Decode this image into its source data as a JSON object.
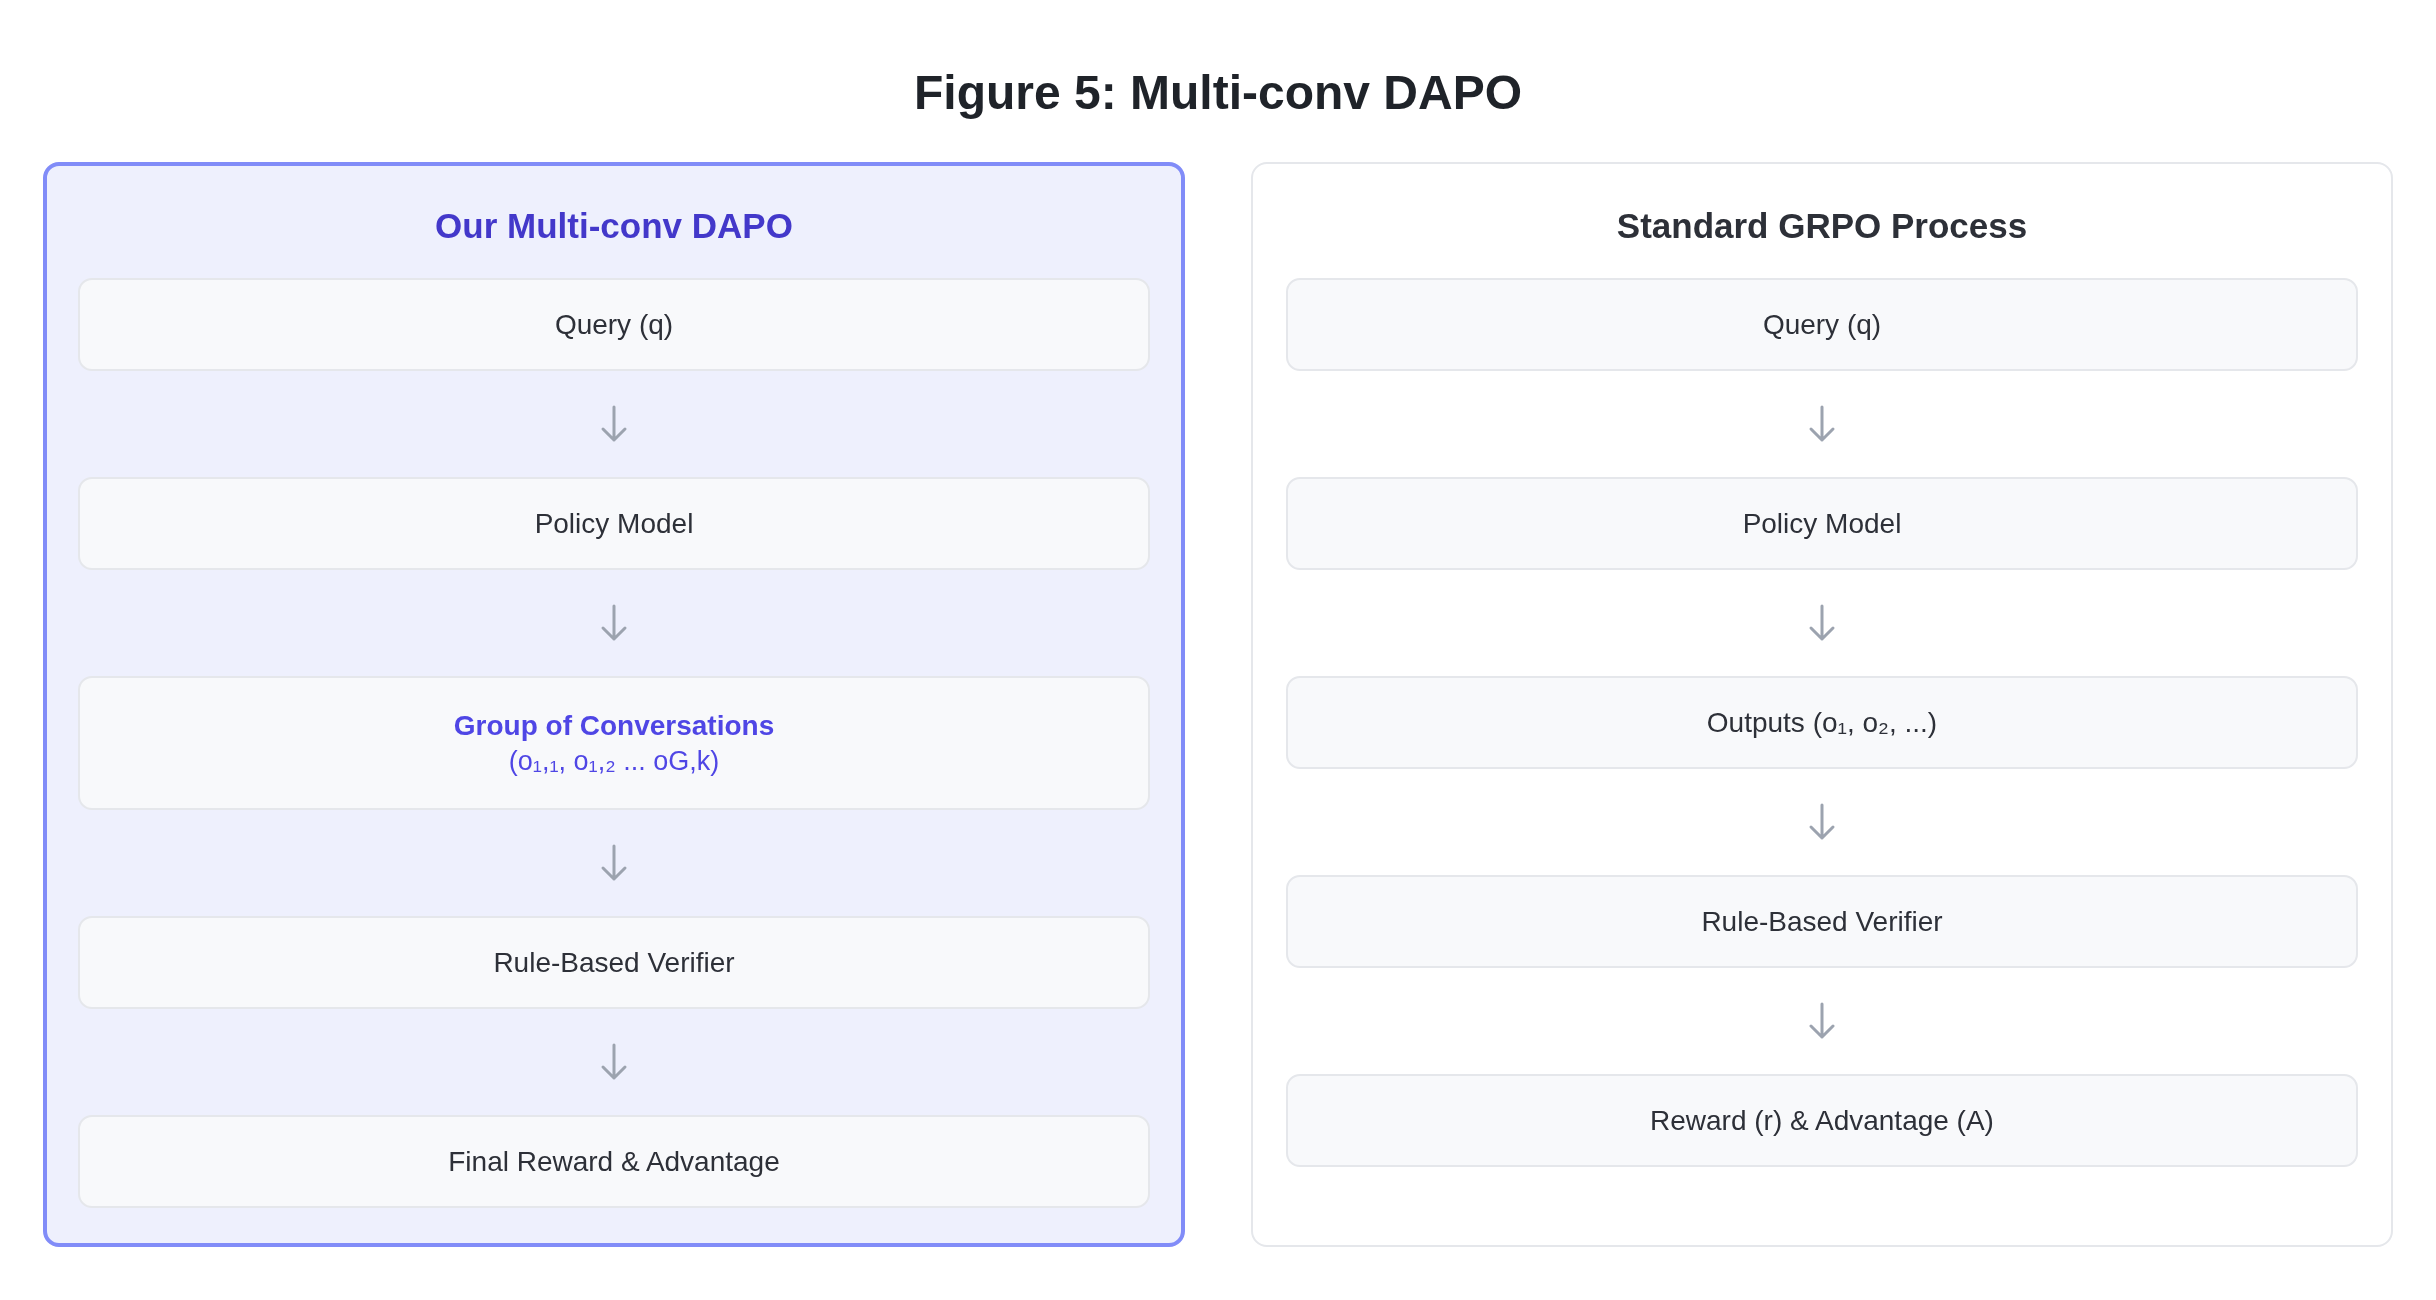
{
  "title": "Figure 5: Multi-conv DAPO",
  "panels": [
    {
      "title": "Our Multi-conv DAPO",
      "highlighted": true,
      "steps": [
        {
          "kind": "plain",
          "label": "Query (q)"
        },
        {
          "kind": "plain",
          "label": "Policy Model"
        },
        {
          "kind": "highlight",
          "label": "Group of Conversations",
          "detail": "(o₁,₁, o₁,₂ ... oG,k)"
        },
        {
          "kind": "plain",
          "label": "Rule-Based Verifier"
        },
        {
          "kind": "plain",
          "label": "Final Reward & Advantage"
        }
      ]
    },
    {
      "title": "Standard GRPO Process",
      "highlighted": false,
      "steps": [
        {
          "kind": "plain",
          "label": "Query (q)"
        },
        {
          "kind": "plain",
          "label": "Policy Model"
        },
        {
          "kind": "plain",
          "label": "Outputs (o₁, o₂, ...)"
        },
        {
          "kind": "plain",
          "label": "Rule-Based Verifier"
        },
        {
          "kind": "plain",
          "label": "Reward (r) & Advantage (A)"
        }
      ]
    }
  ]
}
